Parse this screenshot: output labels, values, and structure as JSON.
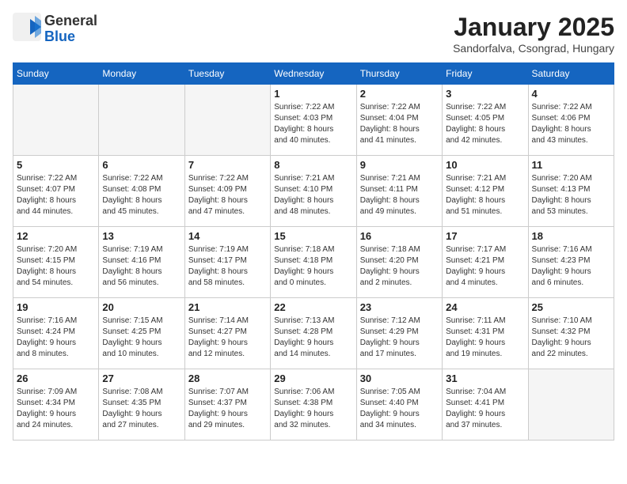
{
  "logo": {
    "general": "General",
    "blue": "Blue"
  },
  "title": "January 2025",
  "subtitle": "Sandorfalva, Csongrad, Hungary",
  "days_of_week": [
    "Sunday",
    "Monday",
    "Tuesday",
    "Wednesday",
    "Thursday",
    "Friday",
    "Saturday"
  ],
  "weeks": [
    [
      {
        "day": "",
        "info": ""
      },
      {
        "day": "",
        "info": ""
      },
      {
        "day": "",
        "info": ""
      },
      {
        "day": "1",
        "info": "Sunrise: 7:22 AM\nSunset: 4:03 PM\nDaylight: 8 hours\nand 40 minutes."
      },
      {
        "day": "2",
        "info": "Sunrise: 7:22 AM\nSunset: 4:04 PM\nDaylight: 8 hours\nand 41 minutes."
      },
      {
        "day": "3",
        "info": "Sunrise: 7:22 AM\nSunset: 4:05 PM\nDaylight: 8 hours\nand 42 minutes."
      },
      {
        "day": "4",
        "info": "Sunrise: 7:22 AM\nSunset: 4:06 PM\nDaylight: 8 hours\nand 43 minutes."
      }
    ],
    [
      {
        "day": "5",
        "info": "Sunrise: 7:22 AM\nSunset: 4:07 PM\nDaylight: 8 hours\nand 44 minutes."
      },
      {
        "day": "6",
        "info": "Sunrise: 7:22 AM\nSunset: 4:08 PM\nDaylight: 8 hours\nand 45 minutes."
      },
      {
        "day": "7",
        "info": "Sunrise: 7:22 AM\nSunset: 4:09 PM\nDaylight: 8 hours\nand 47 minutes."
      },
      {
        "day": "8",
        "info": "Sunrise: 7:21 AM\nSunset: 4:10 PM\nDaylight: 8 hours\nand 48 minutes."
      },
      {
        "day": "9",
        "info": "Sunrise: 7:21 AM\nSunset: 4:11 PM\nDaylight: 8 hours\nand 49 minutes."
      },
      {
        "day": "10",
        "info": "Sunrise: 7:21 AM\nSunset: 4:12 PM\nDaylight: 8 hours\nand 51 minutes."
      },
      {
        "day": "11",
        "info": "Sunrise: 7:20 AM\nSunset: 4:13 PM\nDaylight: 8 hours\nand 53 minutes."
      }
    ],
    [
      {
        "day": "12",
        "info": "Sunrise: 7:20 AM\nSunset: 4:15 PM\nDaylight: 8 hours\nand 54 minutes."
      },
      {
        "day": "13",
        "info": "Sunrise: 7:19 AM\nSunset: 4:16 PM\nDaylight: 8 hours\nand 56 minutes."
      },
      {
        "day": "14",
        "info": "Sunrise: 7:19 AM\nSunset: 4:17 PM\nDaylight: 8 hours\nand 58 minutes."
      },
      {
        "day": "15",
        "info": "Sunrise: 7:18 AM\nSunset: 4:18 PM\nDaylight: 9 hours\nand 0 minutes."
      },
      {
        "day": "16",
        "info": "Sunrise: 7:18 AM\nSunset: 4:20 PM\nDaylight: 9 hours\nand 2 minutes."
      },
      {
        "day": "17",
        "info": "Sunrise: 7:17 AM\nSunset: 4:21 PM\nDaylight: 9 hours\nand 4 minutes."
      },
      {
        "day": "18",
        "info": "Sunrise: 7:16 AM\nSunset: 4:23 PM\nDaylight: 9 hours\nand 6 minutes."
      }
    ],
    [
      {
        "day": "19",
        "info": "Sunrise: 7:16 AM\nSunset: 4:24 PM\nDaylight: 9 hours\nand 8 minutes."
      },
      {
        "day": "20",
        "info": "Sunrise: 7:15 AM\nSunset: 4:25 PM\nDaylight: 9 hours\nand 10 minutes."
      },
      {
        "day": "21",
        "info": "Sunrise: 7:14 AM\nSunset: 4:27 PM\nDaylight: 9 hours\nand 12 minutes."
      },
      {
        "day": "22",
        "info": "Sunrise: 7:13 AM\nSunset: 4:28 PM\nDaylight: 9 hours\nand 14 minutes."
      },
      {
        "day": "23",
        "info": "Sunrise: 7:12 AM\nSunset: 4:29 PM\nDaylight: 9 hours\nand 17 minutes."
      },
      {
        "day": "24",
        "info": "Sunrise: 7:11 AM\nSunset: 4:31 PM\nDaylight: 9 hours\nand 19 minutes."
      },
      {
        "day": "25",
        "info": "Sunrise: 7:10 AM\nSunset: 4:32 PM\nDaylight: 9 hours\nand 22 minutes."
      }
    ],
    [
      {
        "day": "26",
        "info": "Sunrise: 7:09 AM\nSunset: 4:34 PM\nDaylight: 9 hours\nand 24 minutes."
      },
      {
        "day": "27",
        "info": "Sunrise: 7:08 AM\nSunset: 4:35 PM\nDaylight: 9 hours\nand 27 minutes."
      },
      {
        "day": "28",
        "info": "Sunrise: 7:07 AM\nSunset: 4:37 PM\nDaylight: 9 hours\nand 29 minutes."
      },
      {
        "day": "29",
        "info": "Sunrise: 7:06 AM\nSunset: 4:38 PM\nDaylight: 9 hours\nand 32 minutes."
      },
      {
        "day": "30",
        "info": "Sunrise: 7:05 AM\nSunset: 4:40 PM\nDaylight: 9 hours\nand 34 minutes."
      },
      {
        "day": "31",
        "info": "Sunrise: 7:04 AM\nSunset: 4:41 PM\nDaylight: 9 hours\nand 37 minutes."
      },
      {
        "day": "",
        "info": ""
      }
    ]
  ]
}
